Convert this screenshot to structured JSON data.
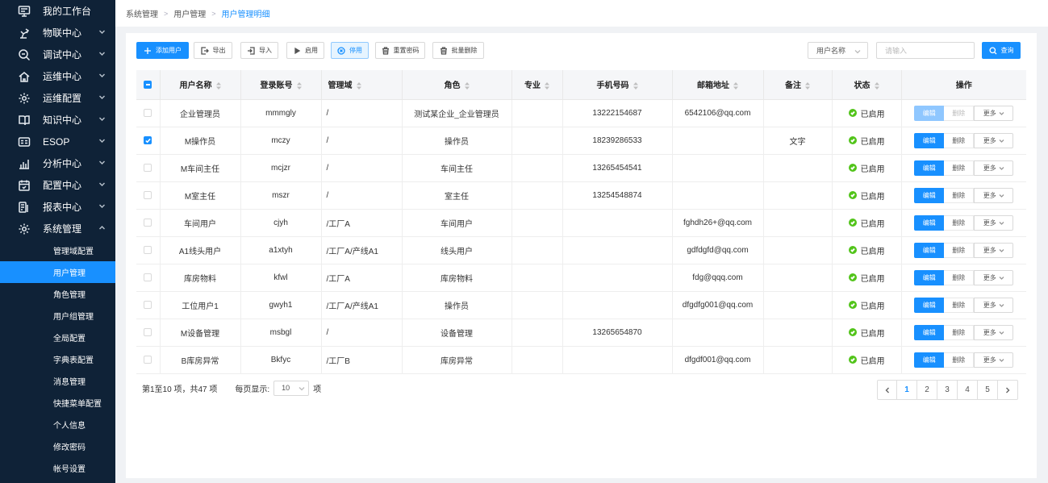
{
  "sidebar": {
    "items": [
      {
        "label": "我的工作台",
        "icon": "monitor-icon"
      },
      {
        "label": "物联中心",
        "icon": "robot-arm-icon"
      },
      {
        "label": "调试中心",
        "icon": "search-icon"
      },
      {
        "label": "运维中心",
        "icon": "home-icon"
      },
      {
        "label": "运维配置",
        "icon": "gear-icon"
      },
      {
        "label": "知识中心",
        "icon": "book-icon"
      },
      {
        "label": "ESOP",
        "icon": "esop-icon"
      },
      {
        "label": "分析中心",
        "icon": "bar-chart-icon"
      },
      {
        "label": "配置中心",
        "icon": "calendar-icon"
      },
      {
        "label": "报表中心",
        "icon": "report-icon"
      },
      {
        "label": "系统管理",
        "icon": "gear-icon"
      }
    ],
    "sub_items": [
      {
        "label": "管理域配置",
        "active": false
      },
      {
        "label": "用户管理",
        "active": true
      },
      {
        "label": "角色管理",
        "active": false
      },
      {
        "label": "用户组管理",
        "active": false
      },
      {
        "label": "全局配置",
        "active": false
      },
      {
        "label": "字典表配置",
        "active": false
      },
      {
        "label": "消息管理",
        "active": false
      },
      {
        "label": "快捷菜单配置",
        "active": false
      },
      {
        "label": "个人信息",
        "active": false
      },
      {
        "label": "修改密码",
        "active": false
      },
      {
        "label": "帐号设置",
        "active": false
      }
    ]
  },
  "breadcrumb": [
    "系统管理",
    "用户管理",
    "用户管理明细"
  ],
  "toolbar": {
    "add_user": "添加用户",
    "export": "导出",
    "import": "导入",
    "enable": "启用",
    "disable": "停用",
    "reset_password": "重置密码",
    "batch_delete": "批量删除",
    "search_field": "用户名称",
    "search_placeholder": "请输入",
    "search_button": "查询"
  },
  "table": {
    "headers": [
      "用户名称",
      "登录账号",
      "管理域",
      "角色",
      "专业",
      "手机号码",
      "邮箱地址",
      "备注",
      "状态",
      "操作"
    ],
    "rows": [
      {
        "name": "企业管理员",
        "account": "mmmgly",
        "domain": "/",
        "role": "测试某企业_企业管理员",
        "major": "",
        "phone": "13222154687",
        "email": "6542106@qq.com",
        "note": "",
        "status": "已启用",
        "checked": false,
        "edit_disabled": true
      },
      {
        "name": "M操作员",
        "account": "mczy",
        "domain": "/",
        "role": "操作员",
        "major": "",
        "phone": "18239286533",
        "email": "",
        "note": "文字",
        "status": "已启用",
        "checked": true,
        "edit_disabled": false
      },
      {
        "name": "M车间主任",
        "account": "mcjzr",
        "domain": "/",
        "role": "车间主任",
        "major": "",
        "phone": "13265454541",
        "email": "",
        "note": "",
        "status": "已启用",
        "checked": false,
        "edit_disabled": false
      },
      {
        "name": "M室主任",
        "account": "mszr",
        "domain": "/",
        "role": "室主任",
        "major": "",
        "phone": "13254548874",
        "email": "",
        "note": "",
        "status": "已启用",
        "checked": false,
        "edit_disabled": false
      },
      {
        "name": "车间用户",
        "account": "cjyh",
        "domain": "/工厂A",
        "role": "车间用户",
        "major": "",
        "phone": "",
        "email": "fghdh26+@qq.com",
        "note": "",
        "status": "已启用",
        "checked": false,
        "edit_disabled": false
      },
      {
        "name": "A1线头用户",
        "account": "a1xtyh",
        "domain": "/工厂A/产线A1",
        "role": "线头用户",
        "major": "",
        "phone": "",
        "email": "gdfdgfd@qq.com",
        "note": "",
        "status": "已启用",
        "checked": false,
        "edit_disabled": false
      },
      {
        "name": "库房物料",
        "account": "kfwl",
        "domain": "/工厂A",
        "role": "库房物料",
        "major": "",
        "phone": "",
        "email": "fdg@qqq.com",
        "note": "",
        "status": "已启用",
        "checked": false,
        "edit_disabled": false
      },
      {
        "name": "工位用户1",
        "account": "gwyh1",
        "domain": "/工厂A/产线A1",
        "role": "操作员",
        "major": "",
        "phone": "",
        "email": "dfgdfg001@qq.com",
        "note": "",
        "status": "已启用",
        "checked": false,
        "edit_disabled": false
      },
      {
        "name": "M设备管理",
        "account": "msbgl",
        "domain": "/",
        "role": "设备管理",
        "major": "",
        "phone": "13265654870",
        "email": "",
        "note": "",
        "status": "已启用",
        "checked": false,
        "edit_disabled": false
      },
      {
        "name": "B库房异常",
        "account": "Bkfyc",
        "domain": "/工厂B",
        "role": "库房异常",
        "major": "",
        "phone": "",
        "email": "dfgdf001@qq.com",
        "note": "",
        "status": "已启用",
        "checked": false,
        "edit_disabled": false
      }
    ],
    "op_edit": "编辑",
    "op_delete": "删除",
    "op_more": "更多"
  },
  "footer": {
    "range_text": "第1至10 项，共47  项",
    "page_size_label": "每页显示:",
    "page_size": "10",
    "page_size_unit": "项"
  },
  "pagination": {
    "pages": [
      "1",
      "2",
      "3",
      "4",
      "5"
    ],
    "current": "1"
  },
  "colors": {
    "sidebar_bg": "#0f2237",
    "accent": "#1890ff",
    "status_green": "#52c41a"
  }
}
